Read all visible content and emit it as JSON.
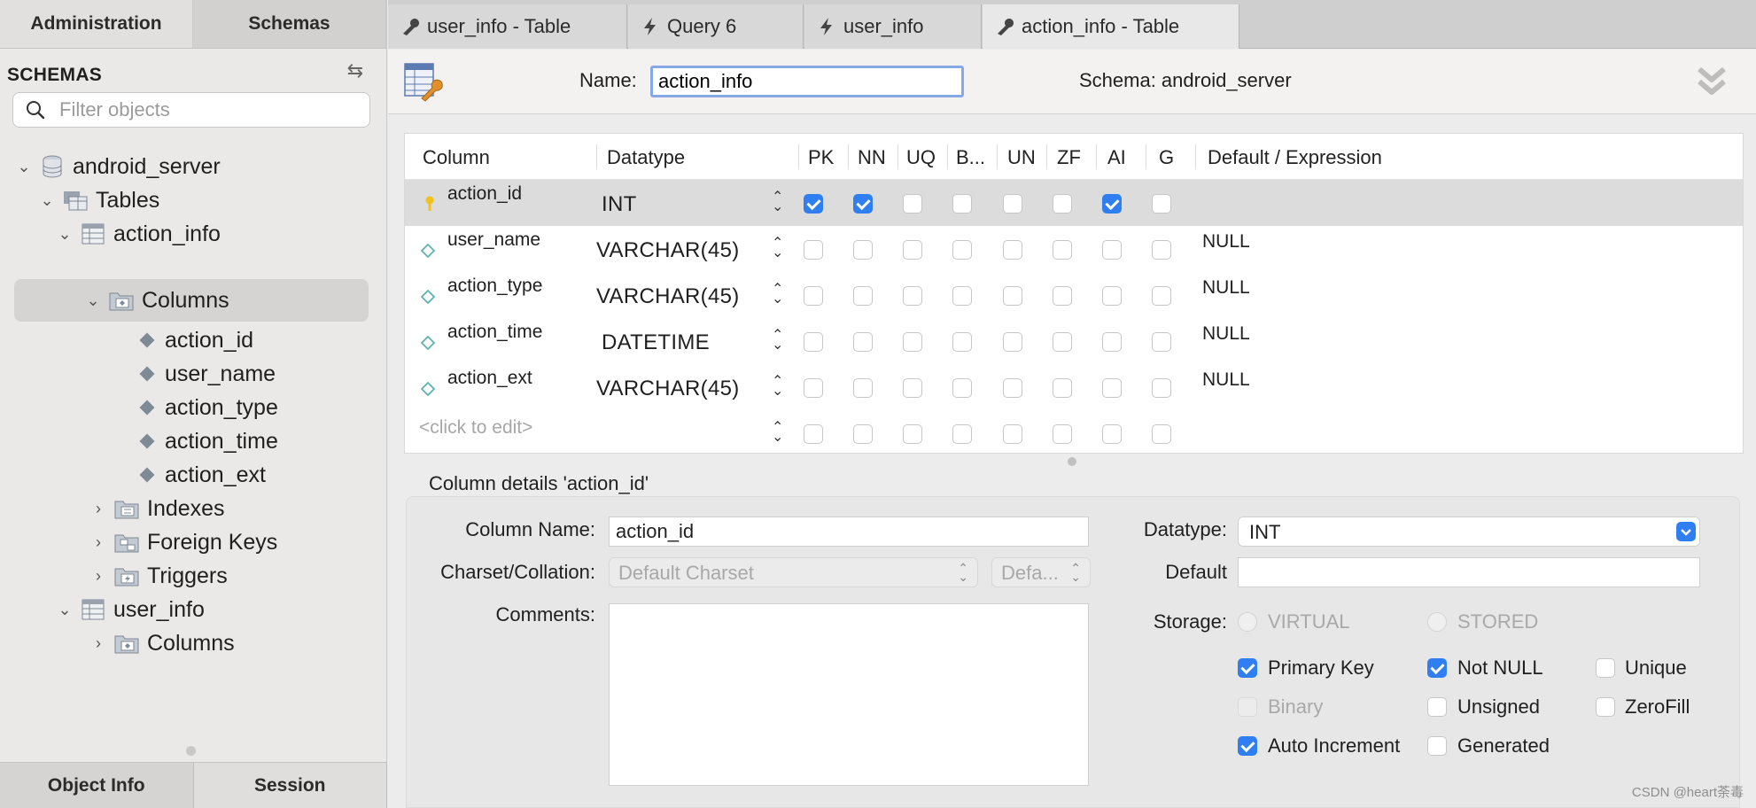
{
  "sidebar": {
    "tabs": [
      "Administration",
      "Schemas"
    ],
    "schemas_title": "SCHEMAS",
    "filter_placeholder": "Filter objects",
    "tree": {
      "schema": "android_server",
      "tables": "Tables",
      "table1": "action_info",
      "columns": "Columns",
      "col1": "action_id",
      "col2": "user_name",
      "col3": "action_type",
      "col4": "action_time",
      "col5": "action_ext",
      "indexes": "Indexes",
      "foreign_keys": "Foreign Keys",
      "triggers": "Triggers",
      "table2": "user_info",
      "columns2": "Columns"
    },
    "bottom_tabs": [
      "Object Info",
      "Session"
    ]
  },
  "tabs": [
    "user_info - Table",
    "Query 6",
    "user_info",
    "action_info - Table"
  ],
  "editor": {
    "name_label": "Name:",
    "name_value": "action_info",
    "schema_label": "Schema:  android_server"
  },
  "grid": {
    "headers": [
      "Column",
      "Datatype",
      "PK",
      "NN",
      "UQ",
      "B...",
      "UN",
      "ZF",
      "AI",
      "G",
      "Default / Expression"
    ],
    "rows": [
      {
        "name": "action_id",
        "type": "INT",
        "checks": [
          true,
          true,
          false,
          false,
          false,
          false,
          true,
          false
        ],
        "default": ""
      },
      {
        "name": "user_name",
        "type": "VARCHAR(45)",
        "checks": [
          false,
          false,
          false,
          false,
          false,
          false,
          false,
          false
        ],
        "default": "NULL"
      },
      {
        "name": "action_type",
        "type": "VARCHAR(45)",
        "checks": [
          false,
          false,
          false,
          false,
          false,
          false,
          false,
          false
        ],
        "default": "NULL"
      },
      {
        "name": "action_time",
        "type": "DATETIME",
        "checks": [
          false,
          false,
          false,
          false,
          false,
          false,
          false,
          false
        ],
        "default": "NULL"
      },
      {
        "name": "action_ext",
        "type": "VARCHAR(45)",
        "checks": [
          false,
          false,
          false,
          false,
          false,
          false,
          false,
          false
        ],
        "default": "NULL"
      }
    ],
    "click_to_edit": "<click to edit>"
  },
  "details": {
    "title": "Column details 'action_id'",
    "column_name_label": "Column Name:",
    "column_name_value": "action_id",
    "charset_label": "Charset/Collation:",
    "charset_value": "Default Charset",
    "collation_value": "Defa...",
    "comments_label": "Comments:",
    "datatype_label": "Datatype:",
    "datatype_value": "INT",
    "default_label": "Default",
    "storage_label": "Storage:",
    "storage_options": [
      "VIRTUAL",
      "STORED"
    ],
    "flags": {
      "primary_key": "Primary Key",
      "not_null": "Not NULL",
      "unique": "Unique",
      "binary": "Binary",
      "unsigned": "Unsigned",
      "zerofill": "ZeroFill",
      "auto_increment": "Auto Increment",
      "generated": "Generated"
    }
  },
  "watermark": "CSDN @heart荼毒",
  "colors": {
    "accent": "#2f7ff2",
    "selection": "#d6d4d3"
  }
}
